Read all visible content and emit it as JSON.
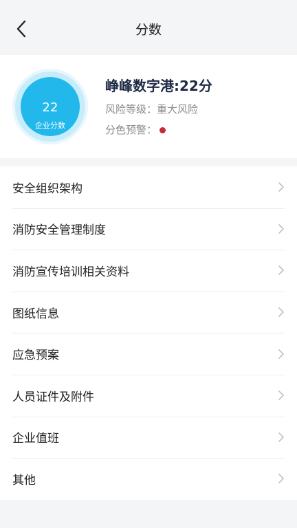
{
  "header": {
    "title": "分数"
  },
  "summary": {
    "score": "22",
    "score_label": "企业分数",
    "company_title": "峥峰数字港:22分",
    "risk_label": "风险等级：",
    "risk_value": "重大风险",
    "color_warning_label": "分色预警：",
    "color_warning_color": "#c8283b",
    "ring_color": "#22b8ec"
  },
  "menu": {
    "items": [
      {
        "label": "安全组织架构"
      },
      {
        "label": "消防安全管理制度"
      },
      {
        "label": "消防宣传培训相关资料"
      },
      {
        "label": "图纸信息"
      },
      {
        "label": "应急预案"
      },
      {
        "label": "人员证件及附件"
      },
      {
        "label": "企业值班"
      },
      {
        "label": "其他"
      }
    ]
  }
}
